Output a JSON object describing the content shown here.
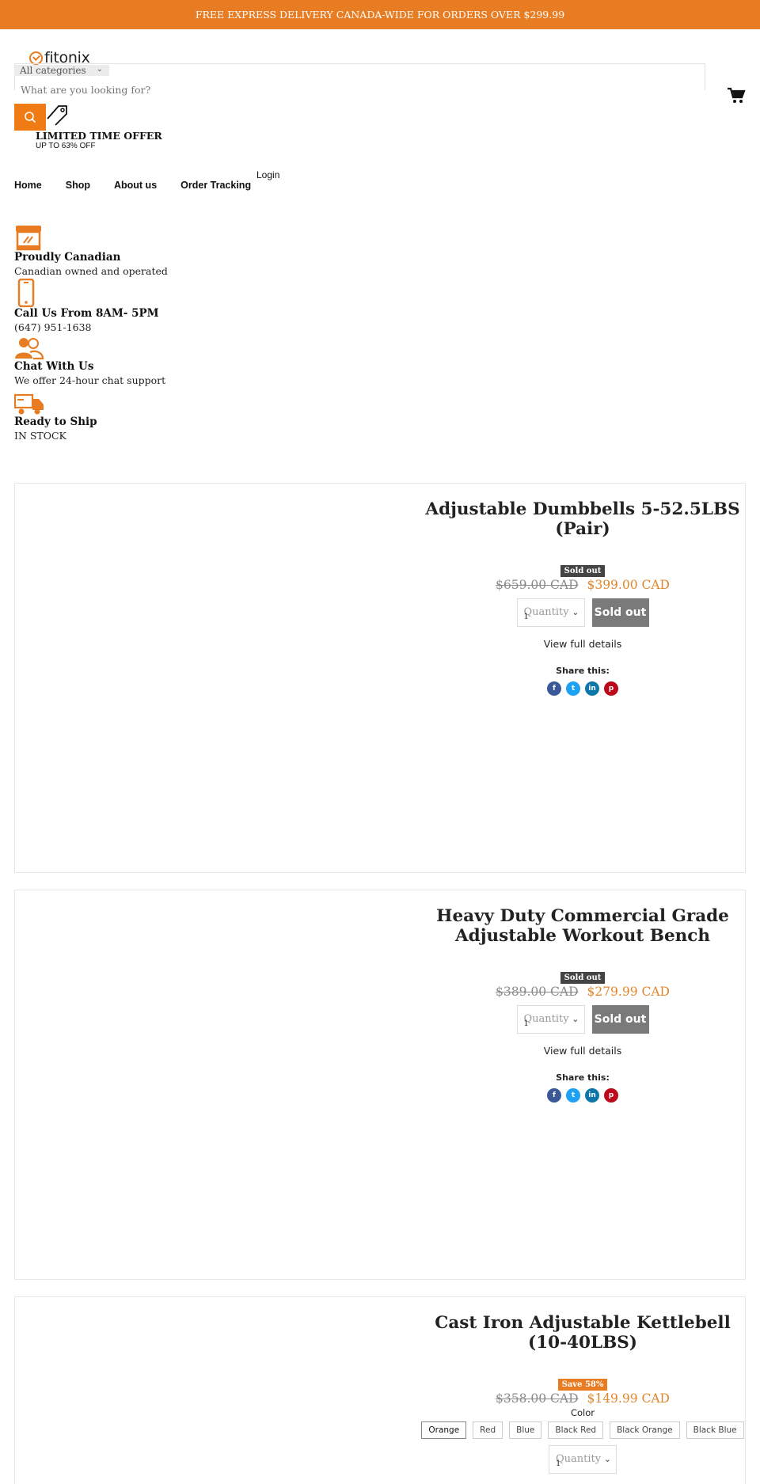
{
  "announcement": "FREE EXPRESS DELIVERY CANADA-WIDE FOR ORDERS OVER $299.99",
  "brand": {
    "name": "fitonix"
  },
  "search": {
    "category": "All categories",
    "placeholder": "What are you looking for?"
  },
  "promo": {
    "title": "LIMITED TIME OFFER",
    "subtitle": "UP TO 63% OFF"
  },
  "nav": {
    "items": [
      "Home",
      "Shop",
      "About us",
      "Order Tracking"
    ],
    "login": "Login"
  },
  "features": [
    {
      "icon": "storefront-icon",
      "title": "Proudly Canadian",
      "text": "Canadian owned and operated"
    },
    {
      "icon": "phone-icon",
      "title": "Call Us From 8AM- 5PM",
      "text": "(647) 951-1638"
    },
    {
      "icon": "chat-support-icon",
      "title": "Chat With Us",
      "text": "We offer 24-hour chat support"
    },
    {
      "icon": "delivery-truck-icon",
      "title": "Ready to Ship",
      "text": "IN STOCK"
    }
  ],
  "products": [
    {
      "title_line1": "Adjustable Dumbbells 5-52.5LBS",
      "title_line2": "(Pair)",
      "badge": "Sold out",
      "old_price": "$659.00 CAD",
      "new_price": "$399.00 CAD",
      "quantity_label": "Quantity",
      "quantity_value": "1",
      "button": "Sold out",
      "details": "View full details",
      "share": "Share this:"
    },
    {
      "title_line1": "Heavy Duty Commercial Grade",
      "title_line2": "Adjustable Workout Bench",
      "badge": "Sold out",
      "old_price": "$389.00 CAD",
      "new_price": "$279.99 CAD",
      "quantity_label": "Quantity",
      "quantity_value": "1",
      "button": "Sold out",
      "details": "View full details",
      "share": "Share this:"
    },
    {
      "title_line1": "Cast Iron Adjustable Kettlebell",
      "title_line2": "(10-40LBS)",
      "badge": "Save 58%",
      "old_price": "$358.00 CAD",
      "new_price": "$149.99 CAD",
      "color_label": "Color",
      "colors": [
        "Orange",
        "Red",
        "Blue",
        "Black Red",
        "Black Orange",
        "Black Blue"
      ],
      "quantity_label": "Quantity",
      "quantity_value": "1"
    }
  ],
  "colors": {
    "accent": "#e87c22",
    "button_orange": "#f07a13",
    "sold_out_button": "#7a7a7a",
    "sale_price": "#e0862a"
  }
}
